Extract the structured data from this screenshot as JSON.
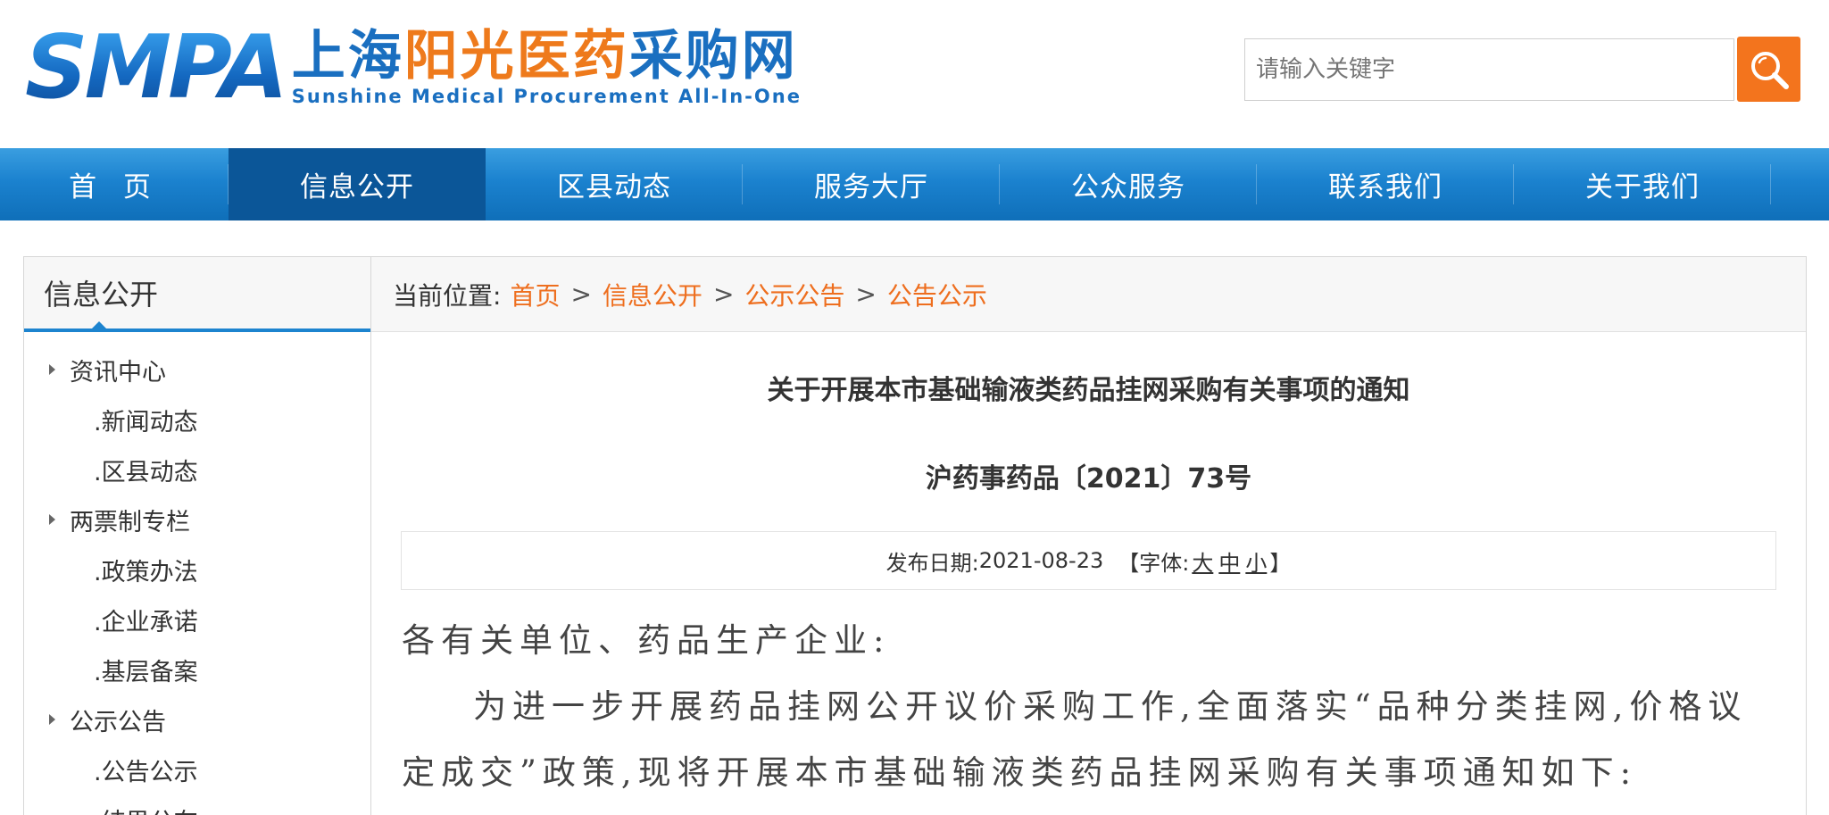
{
  "header": {
    "logo_mark": "SMPA",
    "logo_cn_part1": "上海",
    "logo_cn_part2": "阳光医药",
    "logo_cn_part3": "采购网",
    "logo_en": "Sunshine Medical Procurement All-In-One",
    "search_placeholder": "请输入关键字",
    "search_icon": "magnifier-icon",
    "colors": {
      "brand_blue": "#1a6fc0",
      "brand_orange": "#ee7a1c",
      "search_button": "#f3741d"
    }
  },
  "nav": {
    "items": [
      {
        "label": "首 页"
      },
      {
        "label": "信息公开"
      },
      {
        "label": "区县动态"
      },
      {
        "label": "服务大厅"
      },
      {
        "label": "公众服务"
      },
      {
        "label": "联系我们"
      },
      {
        "label": "关于我们"
      }
    ],
    "active_index": 1,
    "colors": {
      "bar": "#1b82cf",
      "active": "#0b5698"
    }
  },
  "sidebar": {
    "title": "信息公开",
    "items": [
      {
        "label": "资讯中心",
        "type": "group"
      },
      {
        "label": ".新闻动态",
        "type": "sub"
      },
      {
        "label": ".区县动态",
        "type": "sub"
      },
      {
        "label": "两票制专栏",
        "type": "group"
      },
      {
        "label": ".政策办法",
        "type": "sub"
      },
      {
        "label": ".企业承诺",
        "type": "sub"
      },
      {
        "label": ".基层备案",
        "type": "sub"
      },
      {
        "label": "公示公告",
        "type": "group"
      },
      {
        "label": ".公告公示",
        "type": "sub"
      },
      {
        "label": ".结果公布",
        "type": "sub"
      }
    ]
  },
  "breadcrumb": {
    "label": "当前位置:",
    "items": [
      "首页",
      "信息公开",
      "公示公告",
      "公告公示"
    ],
    "separator": ">"
  },
  "article": {
    "title": "关于开展本市基础输液类药品挂网采购有关事项的通知",
    "doc_number": "沪药事药品〔2021〕73号",
    "publish_label": "发布日期:",
    "publish_date": "2021-08-23",
    "font_label_open": "【字体:",
    "font_large": "大",
    "font_medium": "中",
    "font_small": "小",
    "font_label_close": "】",
    "salutation": "各有关单位、药品生产企业:",
    "paragraph1": "为进一步开展药品挂网公开议价采购工作,全面落实“品种分类挂网,价格议定成交”政策,现将开展本市基础输液类药品挂网采购有关事项通知如下:"
  }
}
